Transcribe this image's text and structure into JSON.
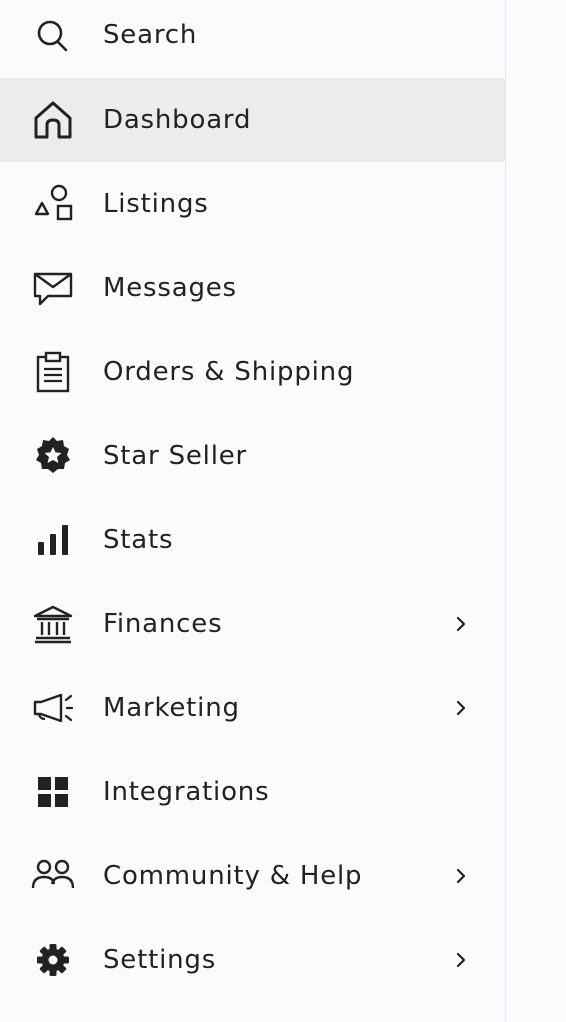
{
  "sidebar": {
    "items": [
      {
        "label": "Search",
        "icon": "search-icon",
        "active": false,
        "has_chevron": false
      },
      {
        "label": "Dashboard",
        "icon": "home-icon",
        "active": true,
        "has_chevron": false
      },
      {
        "label": "Listings",
        "icon": "shapes-icon",
        "active": false,
        "has_chevron": false
      },
      {
        "label": "Messages",
        "icon": "envelope-icon",
        "active": false,
        "has_chevron": false
      },
      {
        "label": "Orders & Shipping",
        "icon": "clipboard-icon",
        "active": false,
        "has_chevron": false
      },
      {
        "label": "Star Seller",
        "icon": "star-badge-icon",
        "active": false,
        "has_chevron": false
      },
      {
        "label": "Stats",
        "icon": "bar-chart-icon",
        "active": false,
        "has_chevron": false
      },
      {
        "label": "Finances",
        "icon": "bank-icon",
        "active": false,
        "has_chevron": true
      },
      {
        "label": "Marketing",
        "icon": "megaphone-icon",
        "active": false,
        "has_chevron": true
      },
      {
        "label": "Integrations",
        "icon": "grid-icon",
        "active": false,
        "has_chevron": false
      },
      {
        "label": "Community & Help",
        "icon": "people-icon",
        "active": false,
        "has_chevron": true
      },
      {
        "label": "Settings",
        "icon": "gear-icon",
        "active": false,
        "has_chevron": true
      }
    ]
  },
  "colors": {
    "text": "#222222",
    "active_background": "#ececee",
    "background": "#fbfbfd",
    "divider": "#e6e6ea"
  }
}
